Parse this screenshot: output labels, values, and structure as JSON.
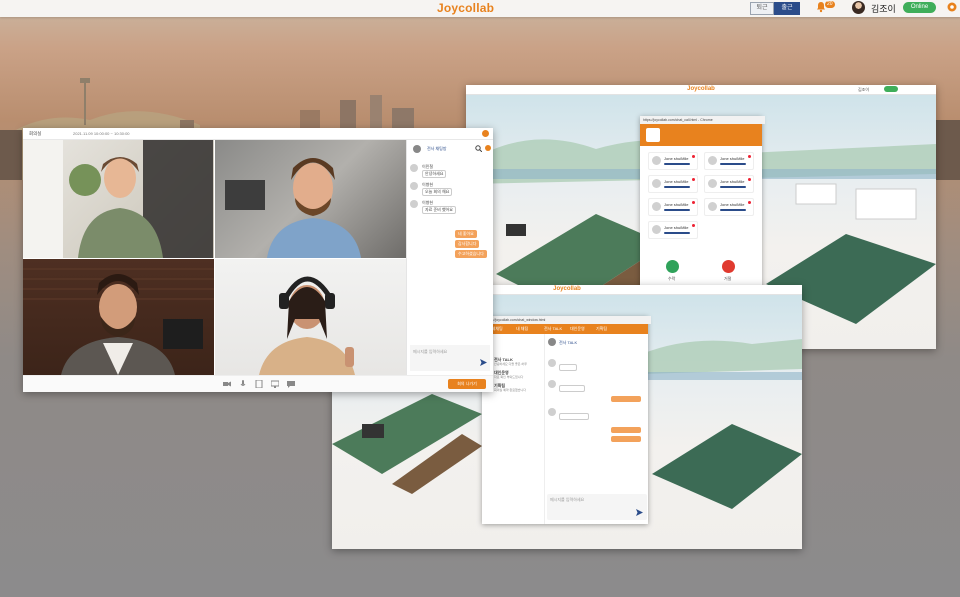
{
  "app": {
    "logo": "Joycollab"
  },
  "header": {
    "toggle_a": "퇴근",
    "toggle_b": "출근",
    "notification_count": "20",
    "user_name": "김조이",
    "status": "Online"
  },
  "colors": {
    "accent": "#e8821e",
    "navy": "#2b4c8a",
    "online": "#3fae5a"
  },
  "video_window": {
    "title": "회의실",
    "datetime": "2021.11.09 10:00:00 ~ 10:30:00",
    "chat_header": "전사 채팅방",
    "composer_placeholder": "메시지를 입력하세요",
    "leave_button": "회의 나가기",
    "messages": [
      {
        "name": "이민철",
        "text": "안녕하세요"
      },
      {
        "name": "이병헌",
        "text": "오늘 회의 해요"
      },
      {
        "name": "이병헌",
        "text": "자료 준비 했어요"
      }
    ],
    "replies": [
      "네 좋아요",
      "감사합니다",
      "수고하셨습니다"
    ]
  },
  "right_window": {
    "logo": "Joycollab",
    "user_name": "김조이",
    "status": "Online",
    "call_title": "https://joycollab.com/chat_call.html - Chrome",
    "participants": [
      "Jone shuiMile",
      "Jone shuiMile",
      "Jone shuiMile",
      "Jone shuiMile",
      "Jone shuiMile",
      "Jone shuiMile",
      "Jone shuiMile"
    ],
    "accept_label": "수락",
    "decline_label": "거절"
  },
  "bottom_window": {
    "logo": "Joycollab",
    "chat_url": "https://joycollab.com/chat_window.html",
    "tabs": [
      "전사 TALK",
      "대인운영",
      "기획팀"
    ],
    "list_tabs": [
      "전체채팅",
      "내 채팅"
    ],
    "room_title": "전사 TALK",
    "rooms": [
      {
        "name": "전사 TALK",
        "preview": "안녕하세요 다들 좋은 하루"
      },
      {
        "name": "대인운영",
        "preview": "자료 확인 부탁드립니다"
      },
      {
        "name": "기획팀",
        "preview": "회의실 예약 완료했습니다"
      }
    ],
    "composer_placeholder": "메시지를 입력하세요"
  }
}
